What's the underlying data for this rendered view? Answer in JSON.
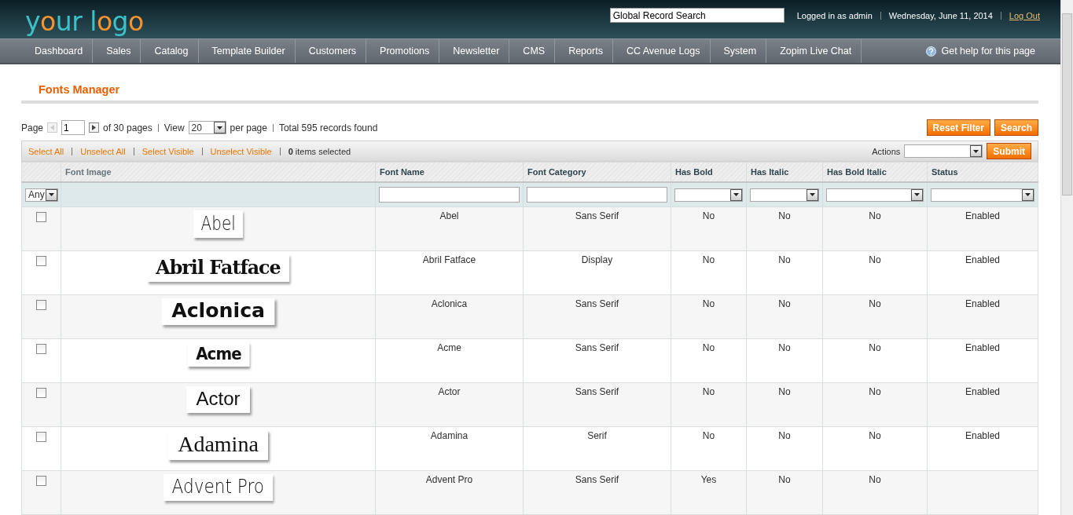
{
  "header": {
    "logo": {
      "parts": [
        {
          "text": "y",
          "accent": false
        },
        {
          "text": "o",
          "accent": true
        },
        {
          "text": "ur l",
          "accent": false
        },
        {
          "text": "o",
          "accent": true
        },
        {
          "text": "g",
          "accent": false
        },
        {
          "text": "o",
          "accent": true
        }
      ]
    },
    "search": {
      "value": "Global Record Search"
    },
    "user": "Logged in as admin",
    "date": "Wednesday, June 11, 2014",
    "logout": "Log Out"
  },
  "nav": {
    "items": [
      "Dashboard",
      "Sales",
      "Catalog",
      "Template Builder",
      "Customers",
      "Promotions",
      "Newsletter",
      "CMS",
      "Reports",
      "CC Avenue Logs",
      "System",
      "Zopim Live Chat"
    ],
    "help": "Get help for this page"
  },
  "page_title": "Fonts Manager",
  "pager": {
    "page_label": "Page",
    "page": "1",
    "of_pages": "of 30 pages",
    "view_label": "View",
    "per_page": "20",
    "per_page_label": "per page",
    "total": "Total 595 records found"
  },
  "buttons": [
    "Reset Filter",
    "Search"
  ],
  "massaction": {
    "links": [
      "Select All",
      "Unselect All",
      "Select Visible",
      "Unselect Visible"
    ],
    "count": "0",
    "count_label": "items selected",
    "actions_label": "Actions",
    "submit": "Submit"
  },
  "table": {
    "columns": [
      {
        "label": "Font Image",
        "kind": "none"
      },
      {
        "label": "Font Name",
        "kind": "text"
      },
      {
        "label": "Font Category",
        "kind": "text"
      },
      {
        "label": "Has Bold",
        "kind": "select"
      },
      {
        "label": "Has Italic",
        "kind": "select"
      },
      {
        "label": "Has Bold Italic",
        "kind": "select"
      },
      {
        "label": "Status",
        "kind": "select"
      }
    ],
    "checkbox_filter": "Any",
    "rows": [
      {
        "checked": false,
        "sample": "Abel",
        "kind": "condensed",
        "name": "Abel",
        "category": "Sans Serif",
        "bold": "No",
        "italic": "No",
        "bold_italic": "No",
        "status": "Enabled"
      },
      {
        "checked": false,
        "sample": "Abril Fatface",
        "kind": "fatface",
        "name": "Abril Fatface",
        "category": "Display",
        "bold": "No",
        "italic": "No",
        "bold_italic": "No",
        "status": "Enabled"
      },
      {
        "checked": false,
        "sample": "Aclonica",
        "kind": "display",
        "name": "Aclonica",
        "category": "Sans Serif",
        "bold": "No",
        "italic": "No",
        "bold_italic": "No",
        "status": "Enabled"
      },
      {
        "checked": false,
        "sample": "Acme",
        "kind": "heavy",
        "name": "Acme",
        "category": "Sans Serif",
        "bold": "No",
        "italic": "No",
        "bold_italic": "No",
        "status": "Enabled"
      },
      {
        "checked": false,
        "sample": "Actor",
        "kind": "sans",
        "name": "Actor",
        "category": "Sans Serif",
        "bold": "No",
        "italic": "No",
        "bold_italic": "No",
        "status": "Enabled"
      },
      {
        "checked": false,
        "sample": "Adamina",
        "kind": "serif",
        "name": "Adamina",
        "category": "Serif",
        "bold": "No",
        "italic": "No",
        "bold_italic": "No",
        "status": "Enabled"
      },
      {
        "checked": false,
        "sample": "Advent Pro",
        "kind": "light",
        "name": "Advent Pro",
        "category": "Sans Serif",
        "bold": "Yes",
        "italic": "No",
        "bold_italic": "No"
      }
    ]
  }
}
